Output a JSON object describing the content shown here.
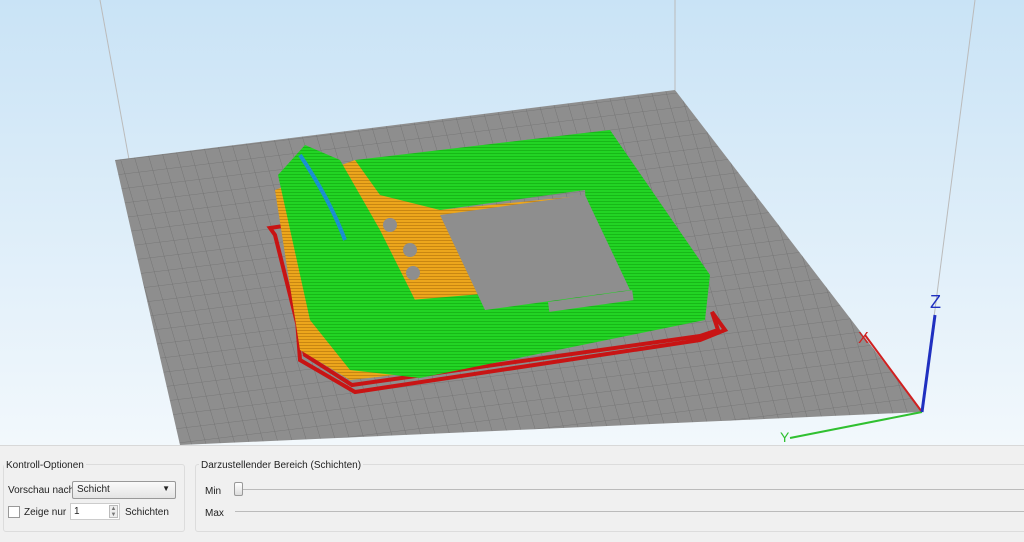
{
  "viewport": {
    "colors": {
      "plate": "#8c8c8c",
      "grid": "#6e6e6e",
      "model_wall": "#1ed01e",
      "model_infill": "#e8a21a",
      "skirt": "#c81414",
      "axis_x": "#d02020",
      "axis_y": "#30c030",
      "axis_z": "#2030c0"
    },
    "axis_labels": {
      "x": "X",
      "y": "Y",
      "z": "Z"
    }
  },
  "controls": {
    "title": "Kontroll-Optionen",
    "preview_label": "Vorschau nach",
    "preview_value": "Schicht",
    "show_only_label": "Zeige nur",
    "show_only_checked": false,
    "layer_count": "1",
    "layers_label": "Schichten"
  },
  "range": {
    "title": "Darzustellender Bereich (Schichten)",
    "min_label": "Min",
    "max_label": "Max",
    "min_value": 0
  }
}
